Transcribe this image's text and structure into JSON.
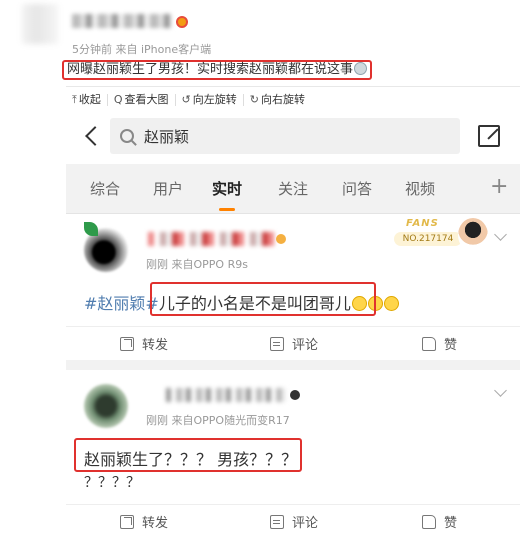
{
  "post": {
    "meta": "5分钟前 来自 iPhone客户端",
    "text": "网曝赵丽颖生了男孩！实时搜索赵丽颖都在说这事"
  },
  "image_toolbar": {
    "items": [
      {
        "icon": "collapse-icon",
        "glyph": "⤒",
        "label": "收起"
      },
      {
        "icon": "zoom-icon",
        "glyph": "Q",
        "label": "查看大图"
      },
      {
        "icon": "rotate-left-icon",
        "glyph": "↺",
        "label": "向左旋转"
      },
      {
        "icon": "rotate-right-icon",
        "glyph": "↻",
        "label": "向右旋转"
      }
    ]
  },
  "screenshot": {
    "search": {
      "query": "赵丽颖"
    },
    "tabs": [
      "综合",
      "用户",
      "实时",
      "关注",
      "问答",
      "视频"
    ],
    "active_tab": "实时",
    "accent_color": "#ff8200",
    "highlight_color": "#e0312e",
    "results": [
      {
        "meta": "刚刚 来自OPPO R9s",
        "fans_title": "FANS",
        "fans_no": "NO.217174",
        "hashtag": "#赵丽颖#",
        "text": "儿子的小名是不是叫团哥儿",
        "actions": {
          "share": "转发",
          "comment": "评论",
          "like": "赞"
        }
      },
      {
        "meta": "刚刚 来自OPPO随光而变R17",
        "text_line1": "赵丽颖生了？？？ 男孩？？？",
        "text_line2": "？？？？",
        "actions": {
          "share": "转发",
          "comment": "评论",
          "like": "赞"
        }
      }
    ]
  }
}
